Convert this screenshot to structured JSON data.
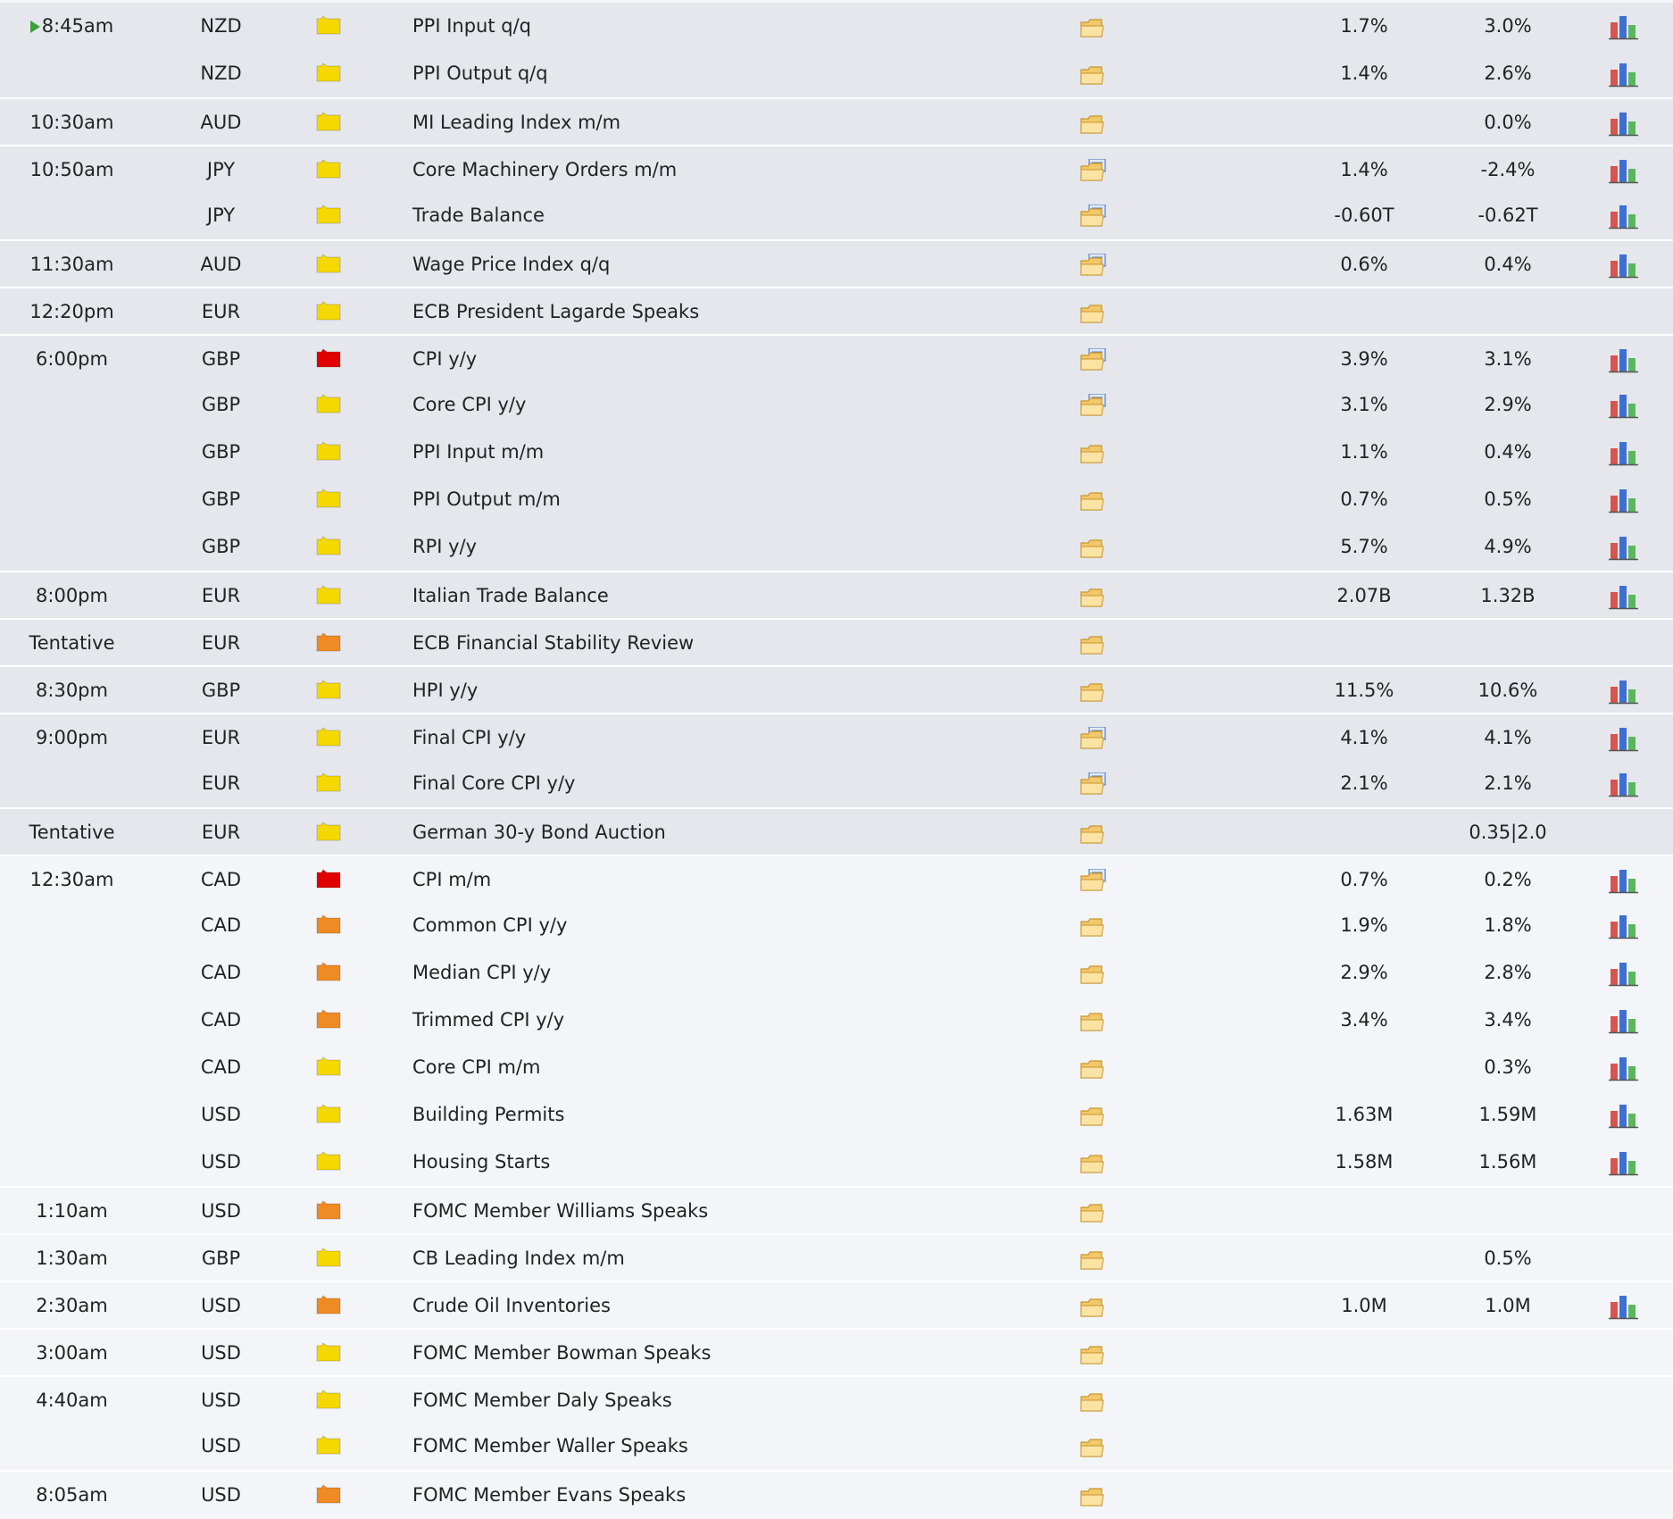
{
  "impact_colors": {
    "yellow": "#f4d800",
    "orange": "#f08a24",
    "red": "#e00000"
  },
  "rows": [
    {
      "time": "8:45am",
      "current": true,
      "currency": "NZD",
      "impact": "yellow",
      "event": "PPI Input q/q",
      "detail": "folder-icon",
      "forecast": "1.7%",
      "previous": "3.0%",
      "graph": true
    },
    {
      "time": "",
      "currency": "NZD",
      "impact": "yellow",
      "event": "PPI Output q/q",
      "detail": "folder-icon",
      "forecast": "1.4%",
      "previous": "2.6%",
      "graph": true
    },
    {
      "time": "10:30am",
      "currency": "AUD",
      "impact": "yellow",
      "event": "MI Leading Index m/m",
      "detail": "folder-icon",
      "forecast": "",
      "previous": "0.0%",
      "graph": true
    },
    {
      "time": "10:50am",
      "currency": "JPY",
      "impact": "yellow",
      "event": "Core Machinery Orders m/m",
      "detail": "folder-doc-icon",
      "forecast": "1.4%",
      "previous": "-2.4%",
      "graph": true
    },
    {
      "time": "",
      "currency": "JPY",
      "impact": "yellow",
      "event": "Trade Balance",
      "detail": "folder-doc-icon",
      "forecast": "-0.60T",
      "previous": "-0.62T",
      "graph": true
    },
    {
      "time": "11:30am",
      "currency": "AUD",
      "impact": "yellow",
      "event": "Wage Price Index q/q",
      "detail": "folder-doc-icon",
      "forecast": "0.6%",
      "previous": "0.4%",
      "graph": true
    },
    {
      "time": "12:20pm",
      "currency": "EUR",
      "impact": "yellow",
      "event": "ECB President Lagarde Speaks",
      "detail": "folder-icon",
      "forecast": "",
      "previous": "",
      "graph": false
    },
    {
      "time": "6:00pm",
      "currency": "GBP",
      "impact": "red",
      "event": "CPI y/y",
      "detail": "folder-doc-icon",
      "forecast": "3.9%",
      "previous": "3.1%",
      "graph": true
    },
    {
      "time": "",
      "currency": "GBP",
      "impact": "yellow",
      "event": "Core CPI y/y",
      "detail": "folder-doc-icon",
      "forecast": "3.1%",
      "previous": "2.9%",
      "graph": true
    },
    {
      "time": "",
      "currency": "GBP",
      "impact": "yellow",
      "event": "PPI Input m/m",
      "detail": "folder-icon",
      "forecast": "1.1%",
      "previous": "0.4%",
      "graph": true
    },
    {
      "time": "",
      "currency": "GBP",
      "impact": "yellow",
      "event": "PPI Output m/m",
      "detail": "folder-icon",
      "forecast": "0.7%",
      "previous": "0.5%",
      "graph": true
    },
    {
      "time": "",
      "currency": "GBP",
      "impact": "yellow",
      "event": "RPI y/y",
      "detail": "folder-icon",
      "forecast": "5.7%",
      "previous": "4.9%",
      "graph": true
    },
    {
      "time": "8:00pm",
      "currency": "EUR",
      "impact": "yellow",
      "event": "Italian Trade Balance",
      "detail": "folder-icon",
      "forecast": "2.07B",
      "previous": "1.32B",
      "graph": true
    },
    {
      "time": "Tentative",
      "currency": "EUR",
      "impact": "orange",
      "event": "ECB Financial Stability Review",
      "detail": "folder-icon",
      "forecast": "",
      "previous": "",
      "graph": false
    },
    {
      "time": "8:30pm",
      "currency": "GBP",
      "impact": "yellow",
      "event": "HPI y/y",
      "detail": "folder-icon",
      "forecast": "11.5%",
      "previous": "10.6%",
      "graph": true
    },
    {
      "time": "9:00pm",
      "currency": "EUR",
      "impact": "yellow",
      "event": "Final CPI y/y",
      "detail": "folder-doc-icon",
      "forecast": "4.1%",
      "previous": "4.1%",
      "graph": true
    },
    {
      "time": "",
      "currency": "EUR",
      "impact": "yellow",
      "event": "Final Core CPI y/y",
      "detail": "folder-doc-icon",
      "forecast": "2.1%",
      "previous": "2.1%",
      "graph": true
    },
    {
      "time": "Tentative",
      "currency": "EUR",
      "impact": "yellow",
      "event": "German 30-y Bond Auction",
      "detail": "folder-icon",
      "forecast": "",
      "previous": "0.35|2.0",
      "graph": false
    },
    {
      "time": "12:30am",
      "currency": "CAD",
      "impact": "red",
      "event": "CPI m/m",
      "detail": "folder-doc-icon",
      "forecast": "0.7%",
      "previous": "0.2%",
      "graph": true
    },
    {
      "time": "",
      "currency": "CAD",
      "impact": "orange",
      "event": "Common CPI y/y",
      "detail": "folder-icon",
      "forecast": "1.9%",
      "previous": "1.8%",
      "graph": true
    },
    {
      "time": "",
      "currency": "CAD",
      "impact": "orange",
      "event": "Median CPI y/y",
      "detail": "folder-icon",
      "forecast": "2.9%",
      "previous": "2.8%",
      "graph": true
    },
    {
      "time": "",
      "currency": "CAD",
      "impact": "orange",
      "event": "Trimmed CPI y/y",
      "detail": "folder-icon",
      "forecast": "3.4%",
      "previous": "3.4%",
      "graph": true
    },
    {
      "time": "",
      "currency": "CAD",
      "impact": "yellow",
      "event": "Core CPI m/m",
      "detail": "folder-icon",
      "forecast": "",
      "previous": "0.3%",
      "graph": true
    },
    {
      "time": "",
      "currency": "USD",
      "impact": "yellow",
      "event": "Building Permits",
      "detail": "folder-icon",
      "forecast": "1.63M",
      "previous": "1.59M",
      "graph": true
    },
    {
      "time": "",
      "currency": "USD",
      "impact": "yellow",
      "event": "Housing Starts",
      "detail": "folder-icon",
      "forecast": "1.58M",
      "previous": "1.56M",
      "graph": true
    },
    {
      "time": "1:10am",
      "currency": "USD",
      "impact": "orange",
      "event": "FOMC Member Williams Speaks",
      "detail": "folder-icon",
      "forecast": "",
      "previous": "",
      "graph": false
    },
    {
      "time": "1:30am",
      "currency": "GBP",
      "impact": "yellow",
      "event": "CB Leading Index m/m",
      "detail": "folder-icon",
      "forecast": "",
      "previous": "0.5%",
      "graph": false
    },
    {
      "time": "2:30am",
      "currency": "USD",
      "impact": "orange",
      "event": "Crude Oil Inventories",
      "detail": "folder-icon",
      "forecast": "1.0M",
      "previous": "1.0M",
      "graph": true
    },
    {
      "time": "3:00am",
      "currency": "USD",
      "impact": "yellow",
      "event": "FOMC Member Bowman Speaks",
      "detail": "folder-icon",
      "forecast": "",
      "previous": "",
      "graph": false
    },
    {
      "time": "4:40am",
      "currency": "USD",
      "impact": "yellow",
      "event": "FOMC Member Daly Speaks",
      "detail": "folder-icon",
      "forecast": "",
      "previous": "",
      "graph": false
    },
    {
      "time": "",
      "currency": "USD",
      "impact": "yellow",
      "event": "FOMC Member Waller Speaks",
      "detail": "folder-icon",
      "forecast": "",
      "previous": "",
      "graph": false
    },
    {
      "time": "8:05am",
      "currency": "USD",
      "impact": "orange",
      "event": "FOMC Member Evans Speaks",
      "detail": "folder-icon",
      "forecast": "",
      "previous": "",
      "graph": false
    }
  ]
}
